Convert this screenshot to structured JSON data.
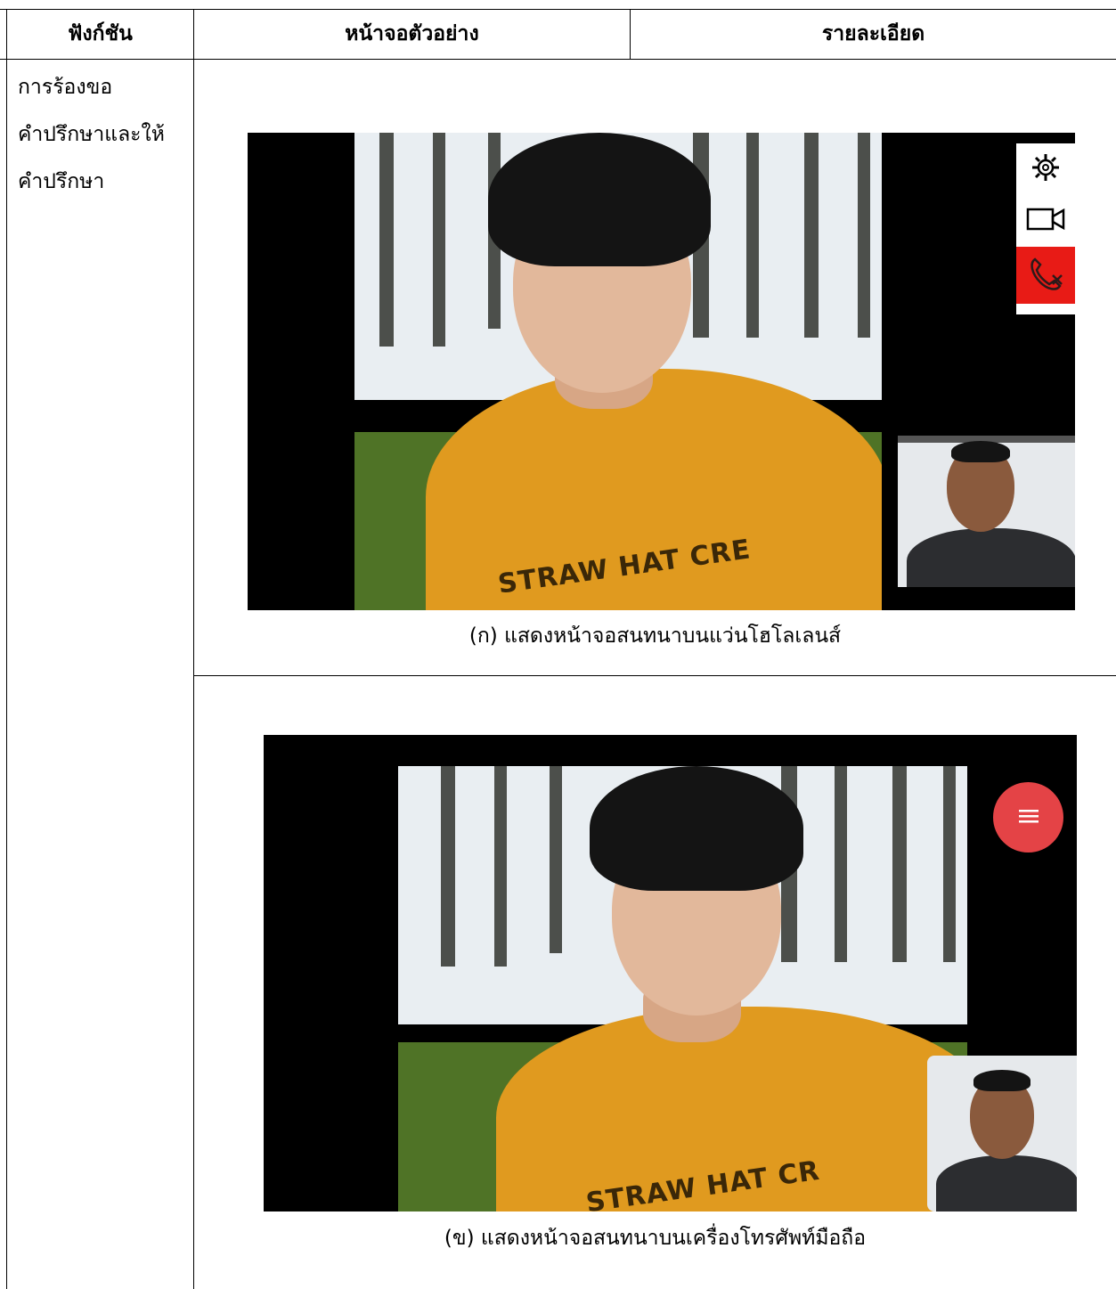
{
  "table": {
    "headers": [
      "ฟังก์ชัน",
      "หน้าจอตัวอย่าง",
      "รายละเอียด"
    ],
    "function_lines": [
      "การร้องขอ",
      "คำปรึกษาและให้",
      "คำปรึกษา"
    ]
  },
  "figures": [
    {
      "caption": "(ก) แสดงหน้าจอสนทนาบนแว่นโฮโลเลนส์",
      "shirt_print": "STRAW HAT CRE",
      "controls": [
        {
          "icon": "settings-icon"
        },
        {
          "icon": "video-camera-icon"
        },
        {
          "icon": "end-call-icon",
          "color": "#e81b16"
        }
      ]
    },
    {
      "caption": "(ข) แสดงหน้าจอสนทนาบนเครื่องโทรศัพท์มือถือ",
      "shirt_print": "STRAW HAT CR",
      "controls": [
        {
          "icon": "menu-icon",
          "color": "#e44346"
        }
      ]
    }
  ],
  "colors": {
    "end_call": "#e81b16",
    "fab": "#e44346",
    "shirt": "#e09a1f"
  }
}
